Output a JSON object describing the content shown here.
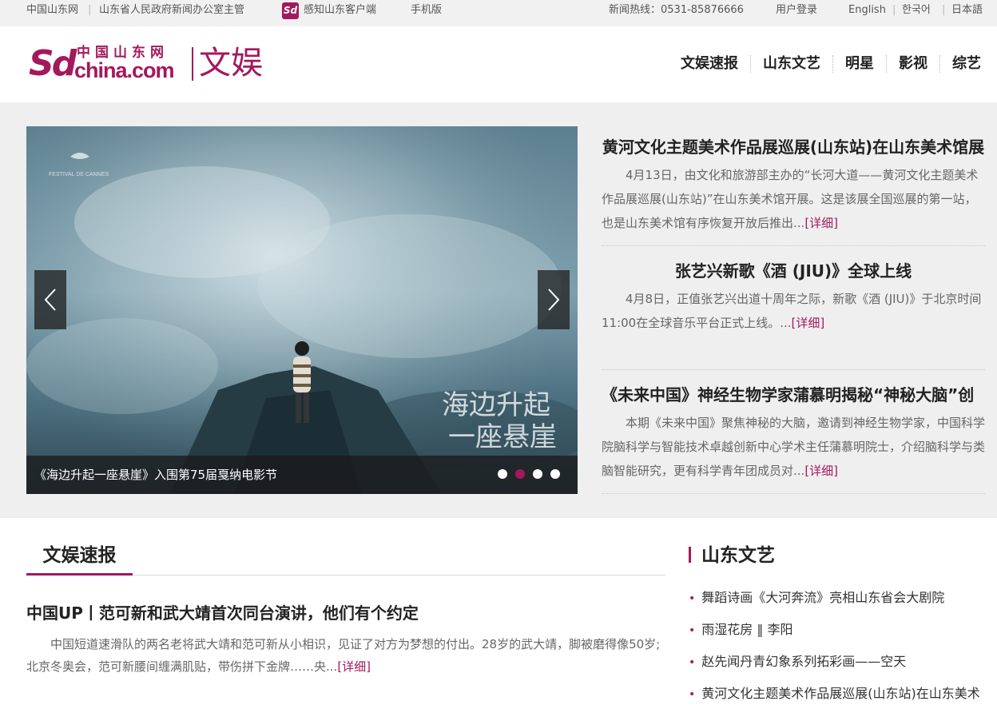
{
  "colors": {
    "accent": "#a4185d",
    "topbar_bg": "#f1f1f1",
    "feature_bg": "#efefef"
  },
  "topbar": {
    "site": "中国山东网",
    "org": "山东省人民政府新闻办公室主管",
    "app_icon": "sd-app-icon",
    "app_label": "感知山东客户端",
    "mobile": "手机版",
    "hotline": "新闻热线：0531-85876666",
    "login": "用户登录",
    "english": "English",
    "korean": "한국어",
    "japanese": "日本語"
  },
  "logo": {
    "sd": "Sd",
    "cn": "中国山东网",
    "domain": "china.com",
    "section": "文娱"
  },
  "nav": [
    "文娱速报",
    "山东文艺",
    "明星",
    "影视",
    "综艺"
  ],
  "slider": {
    "caption": "《海边升起一座悬崖》入围第75届戛纳电影节",
    "festival": "FESTIVAL DE CANNES",
    "overlay_title": "海边升起 一座悬崖",
    "prev_icon": "chevron-left-icon",
    "next_icon": "chevron-right-icon",
    "dots": 4,
    "active_dot": 2
  },
  "stories": [
    {
      "title": "黄河文化主题美术作品展巡展(山东站)在山东美术馆展",
      "summary": "4月13日，由文化和旅游部主办的“长河大道——黄河文化主题美术作品展巡展(山东站)”在山东美术馆开展。这是该展全国巡展的第一站，也是山东美术馆有序恢复开放后推出...",
      "more": "[详细]"
    },
    {
      "title": "张艺兴新歌《酒 (JIU)》全球上线",
      "summary": "4月8日，正值张艺兴出道十周年之际，新歌《酒 (JIU)》于北京时间11:00在全球音乐平台正式上线。...",
      "more": "[详细]"
    },
    {
      "title": "《未来中国》神经生物学家蒲慕明揭秘“神秘大脑”创",
      "summary": "本期《未来中国》聚焦神秘的大脑，邀请到神经生物学家，中国科学院脑科学与智能技术卓越创新中心学术主任蒲慕明院士，介绍脑科学与类脑智能研究，更有科学青年团成员对...",
      "more": "[详细]"
    }
  ],
  "news": {
    "heading": "文娱速报",
    "item": {
      "title": "中国UP丨范可新和武大靖首次同台演讲，他们有个约定",
      "summary": "中国短道速滑队的两名老将武大靖和范可新从小相识，见证了对方为梦想的付出。28岁的武大靖，脚被磨得像50岁;北京冬奥会，范可新腰间缠满肌贴，带伤拼下金牌……央...",
      "more": "[详细]"
    }
  },
  "side": {
    "heading": "山东文艺",
    "items": [
      "舞蹈诗画《大河奔流》亮相山东省会大剧院",
      "雨湿花房 ‖ 李阳",
      "赵先闻丹青幻象系列拓彩画——空天",
      "黄河文化主题美术作品展巡展(山东站)在山东美术"
    ]
  }
}
